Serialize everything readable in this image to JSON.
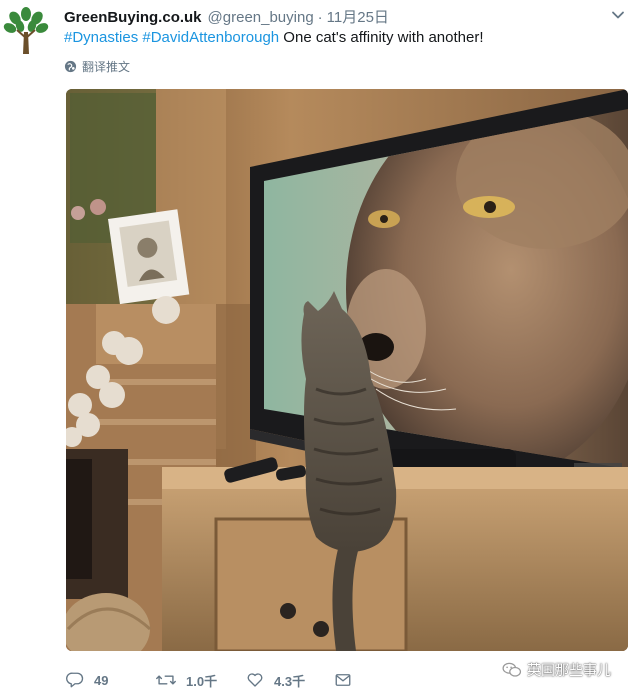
{
  "tweet": {
    "display_name": "GreenBuying.co.uk",
    "handle": "@green_buying",
    "separator": "·",
    "date": "11月25日",
    "text": {
      "hashtag1": "#Dynasties",
      "hashtag2": "#DavidAttenborough",
      "body": " One cat's affinity with another!"
    },
    "translate_label": "翻译推文"
  },
  "actions": {
    "reply_count": "49",
    "retweet_count": "1.0千",
    "like_count": "4.3千"
  },
  "watermark": {
    "text": "英国那些事儿"
  },
  "icons": {
    "avatar": "tree-logo-icon",
    "caret": "chevron-down-icon",
    "translate": "globe-icon",
    "reply": "reply-icon",
    "retweet": "retweet-icon",
    "like": "heart-icon",
    "dm": "envelope-icon",
    "watermark": "wechat-icon"
  },
  "colors": {
    "link": "#1b95e0",
    "muted": "#657786",
    "brand_green": "#3a8a3c"
  }
}
